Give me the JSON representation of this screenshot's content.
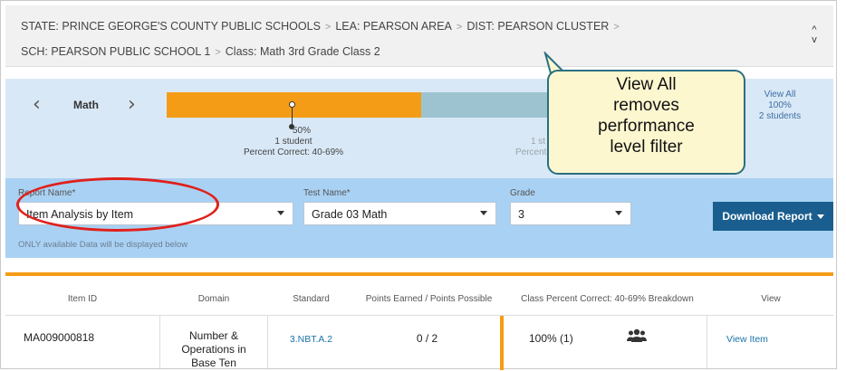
{
  "breadcrumb": {
    "line1": [
      "STATE: PRINCE GEORGE'S COUNTY PUBLIC SCHOOLS",
      "LEA: PEARSON AREA",
      "DIST: PEARSON CLUSTER"
    ],
    "line2": [
      "SCH: PEARSON PUBLIC SCHOOL 1",
      "Class: Math 3rd Grade Class 2"
    ],
    "separator": ">",
    "collapse_up": "^",
    "collapse_down": "v"
  },
  "performance": {
    "prev_glyph": "‹",
    "next_glyph": "›",
    "subject": "Math",
    "segments": [
      {
        "percent": "50%",
        "students": "1 student",
        "range": "Percent Correct: 40-69%",
        "share": 0.5,
        "color": "#f59c16"
      },
      {
        "students": "1 st",
        "range": "Percent Co",
        "share": 0.5,
        "color": "#9dc3d1"
      }
    ],
    "view_all": {
      "label": "View All",
      "percent": "100%",
      "students": "2 students"
    }
  },
  "callout": {
    "lines": [
      "View All",
      "removes",
      "performance",
      "level filter"
    ]
  },
  "filters": {
    "report_label": "Report Name*",
    "report_value": "Item Analysis by Item",
    "test_label": "Test Name*",
    "test_value": "Grade 03 Math",
    "grade_label": "Grade",
    "grade_value": "3",
    "download_label": "Download Report",
    "note": "ONLY available Data will be displayed below"
  },
  "table": {
    "headers": [
      "Item ID",
      "Domain",
      "Standard",
      "Points Earned / Points Possible",
      "Class Percent Correct: 40-69% Breakdown",
      "View"
    ],
    "rows": [
      {
        "item_id": "MA009000818",
        "domain": [
          "Number &",
          "Operations in",
          "Base Ten"
        ],
        "standard": "3.NBT.A.2",
        "points": "0 / 2",
        "class_percent": "100% (1)",
        "view": "View Item"
      }
    ]
  },
  "colors": {
    "orange": "#f59c16",
    "blue_bar": "#9dc3d1",
    "download_bg": "#1a5e8f",
    "annotation_red": "#e0201b",
    "callout_border": "#2a6f80",
    "link": "#1a73a8"
  }
}
